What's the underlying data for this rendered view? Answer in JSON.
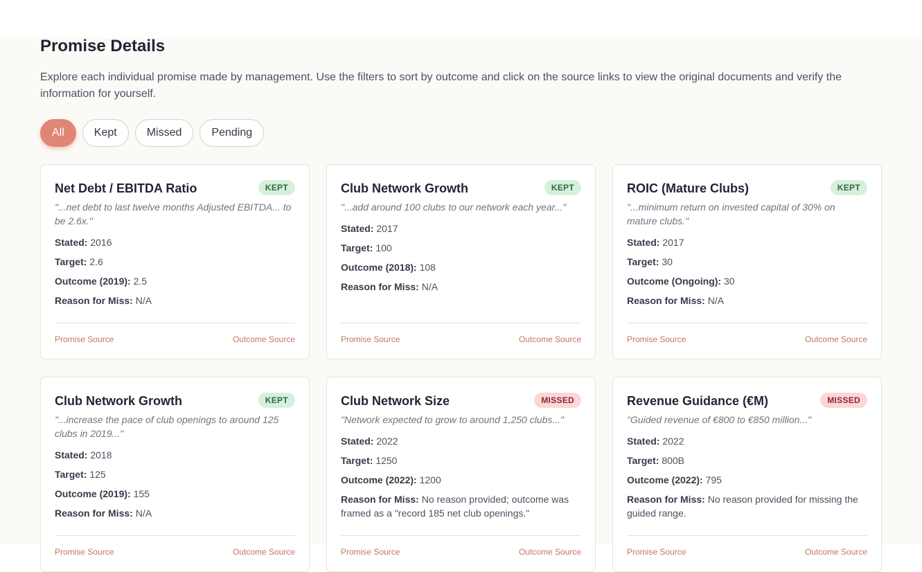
{
  "section": {
    "title": "Promise Details",
    "intro": "Explore each individual promise made by management. Use the filters to sort by outcome and click on the source links to view the original documents and verify the information for yourself."
  },
  "filters": [
    {
      "label": "All",
      "active": true
    },
    {
      "label": "Kept",
      "active": false
    },
    {
      "label": "Missed",
      "active": false
    },
    {
      "label": "Pending",
      "active": false
    }
  ],
  "labels": {
    "stated": "Stated:",
    "target": "Target:",
    "reason": "Reason for Miss:",
    "promise_source": "Promise Source",
    "outcome_source": "Outcome Source"
  },
  "cards": [
    {
      "title": "Net Debt / EBITDA Ratio",
      "status": "KEPT",
      "quote": "\"...net debt to last twelve months Adjusted EBITDA... to be 2.6x.\"",
      "stated": "2016",
      "target": "2.6",
      "outcome_label": "Outcome (2019):",
      "outcome": "2.5",
      "reason": "N/A"
    },
    {
      "title": "Club Network Growth",
      "status": "KEPT",
      "quote": "\"...add around 100 clubs to our network each year...\"",
      "stated": "2017",
      "target": "100",
      "outcome_label": "Outcome (2018):",
      "outcome": "108",
      "reason": "N/A"
    },
    {
      "title": "ROIC (Mature Clubs)",
      "status": "KEPT",
      "quote": "\"...minimum return on invested capital of 30% on mature clubs.\"",
      "stated": "2017",
      "target": "30",
      "outcome_label": "Outcome (Ongoing):",
      "outcome": "30",
      "reason": "N/A"
    },
    {
      "title": "Club Network Growth",
      "status": "KEPT",
      "quote": "\"...increase the pace of club openings to around 125 clubs in 2019...\"",
      "stated": "2018",
      "target": "125",
      "outcome_label": "Outcome (2019):",
      "outcome": "155",
      "reason": "N/A"
    },
    {
      "title": "Club Network Size",
      "status": "MISSED",
      "quote": "\"Network expected to grow to around 1,250 clubs...\"",
      "stated": "2022",
      "target": "1250",
      "outcome_label": "Outcome (2022):",
      "outcome": "1200",
      "reason": "No reason provided; outcome was framed as a \"record 185 net club openings.\""
    },
    {
      "title": "Revenue Guidance (€M)",
      "status": "MISSED",
      "quote": "\"Guided revenue of €800 to €850 million...\"",
      "stated": "2022",
      "target": "800B",
      "outcome_label": "Outcome (2022):",
      "outcome": "795",
      "reason": "No reason provided for missing the guided range."
    }
  ]
}
